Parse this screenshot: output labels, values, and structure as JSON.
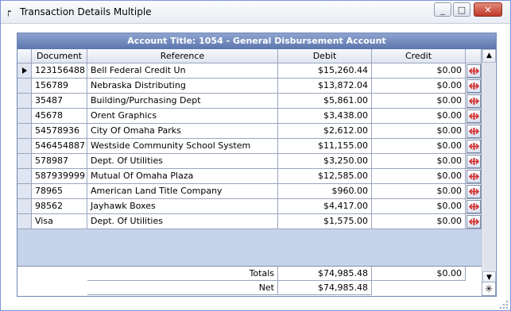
{
  "window": {
    "title": "Transaction Details Multiple",
    "minimize": "_",
    "maximize": "□",
    "close": "✕"
  },
  "grid": {
    "caption": "Account Title: 1054 - General Disbursement Account",
    "columns": [
      "Document",
      "Reference",
      "Debit",
      "Credit"
    ],
    "rows": [
      {
        "document": "123156488",
        "reference": "Bell Federal Credit Un",
        "debit": "$15,260.44",
        "credit": "$0.00",
        "current": true
      },
      {
        "document": "156789",
        "reference": "Nebraska Distributing",
        "debit": "$13,872.04",
        "credit": "$0.00"
      },
      {
        "document": "35487",
        "reference": "Building/Purchasing Dept",
        "debit": "$5,861.00",
        "credit": "$0.00"
      },
      {
        "document": "45678",
        "reference": "Orent Graphics",
        "debit": "$3,438.00",
        "credit": "$0.00"
      },
      {
        "document": "54578936",
        "reference": "City Of Omaha Parks",
        "debit": "$2,612.00",
        "credit": "$0.00"
      },
      {
        "document": "546454887",
        "reference": "Westside Community  School System",
        "debit": "$11,155.00",
        "credit": "$0.00"
      },
      {
        "document": "578987",
        "reference": "Dept. Of Utilities",
        "debit": "$3,250.00",
        "credit": "$0.00"
      },
      {
        "document": "587939999",
        "reference": "Mutual Of Omaha Plaza",
        "debit": "$12,585.00",
        "credit": "$0.00"
      },
      {
        "document": "78965",
        "reference": "American Land Title Company",
        "debit": "$960.00",
        "credit": "$0.00"
      },
      {
        "document": "98562",
        "reference": "Jayhawk Boxes",
        "debit": "$4,417.00",
        "credit": "$0.00"
      },
      {
        "document": "Visa",
        "reference": "Dept. Of Utilities",
        "debit": "$1,575.00",
        "credit": "$0.00"
      }
    ],
    "totals": {
      "totals_label": "Totals",
      "totals_debit": "$74,985.48",
      "totals_credit": "$0.00",
      "net_label": "Net",
      "net_value": "$74,985.48"
    },
    "new_row_symbol": "✳",
    "icons": {
      "row_action": "red-arrow-split-icon",
      "scroll_up": "scroll-up-icon",
      "scroll_down": "scroll-down-icon"
    },
    "colors": {
      "caption_top": "#8ea3cf",
      "caption_bottom": "#5b75ad",
      "row_action_red": "#d32f2f"
    }
  }
}
